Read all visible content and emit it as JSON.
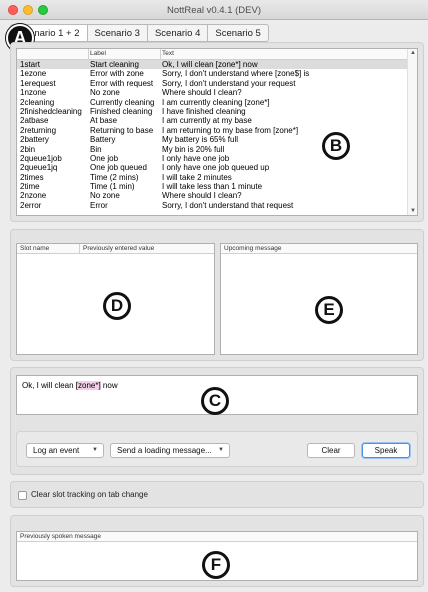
{
  "window": {
    "title": "NottReal v0.4.1 (DEV)"
  },
  "tabs": [
    {
      "label": "Scenario 1 + 2"
    },
    {
      "label": "Scenario 3"
    },
    {
      "label": "Scenario 4"
    },
    {
      "label": "Scenario 5"
    }
  ],
  "markers": {
    "a": "A",
    "b": "B",
    "c": "C",
    "d": "D",
    "e": "E",
    "f": "F"
  },
  "messages_table": {
    "headers": [
      "",
      "Label",
      "Text"
    ],
    "rows": [
      [
        "1start",
        "Start cleaning",
        "Ok, I will clean [zone*] now"
      ],
      [
        "1ezone",
        "Error with zone",
        "Sorry, I don't understand where [zone$] is"
      ],
      [
        "1erequest",
        "Error with request",
        "Sorry, I don't understand your request"
      ],
      [
        "1nzone",
        "No zone",
        "Where should I clean?"
      ],
      [
        "2cleaning",
        "Currently cleaning",
        "I am currently cleaning [zone*]"
      ],
      [
        "2finishedcleaning",
        "Finished cleaning",
        "I have finished cleaning"
      ],
      [
        "2atbase",
        "At base",
        "I am currently at my base"
      ],
      [
        "2returning",
        "Returning to base",
        "I am returning to my base from [zone*]"
      ],
      [
        "2battery",
        "Battery",
        "My battery is 65% full"
      ],
      [
        "2bin",
        "Bin",
        "My bin is 20% full"
      ],
      [
        "2queue1job",
        "One job",
        "I only have one job"
      ],
      [
        "2queue1jq",
        "One job queued",
        "I only have one job queued up"
      ],
      [
        "2times",
        "Time (2 mins)",
        "I will take 2 minutes"
      ],
      [
        "2time",
        "Time (1 min)",
        "I will take less than 1 minute"
      ],
      [
        "2nzone",
        "No zone",
        "Where should I clean?"
      ],
      [
        "2error",
        "Error",
        "Sorry, I don't understand that request"
      ]
    ]
  },
  "slots": {
    "col_name": "Slot name",
    "col_value": "Previously entered value"
  },
  "upcoming": {
    "header": "Upcoming message"
  },
  "message": {
    "before": "Ok, I will clean ",
    "slot": "[zone*]",
    "after": " now"
  },
  "controls": {
    "log_event": "Log an event",
    "loading_message": "Send a loading message...",
    "clear": "Clear",
    "speak": "Speak"
  },
  "options": {
    "clear_slot_tracking": "Clear slot tracking on tab change"
  },
  "history": {
    "header": "Previously spoken message"
  }
}
